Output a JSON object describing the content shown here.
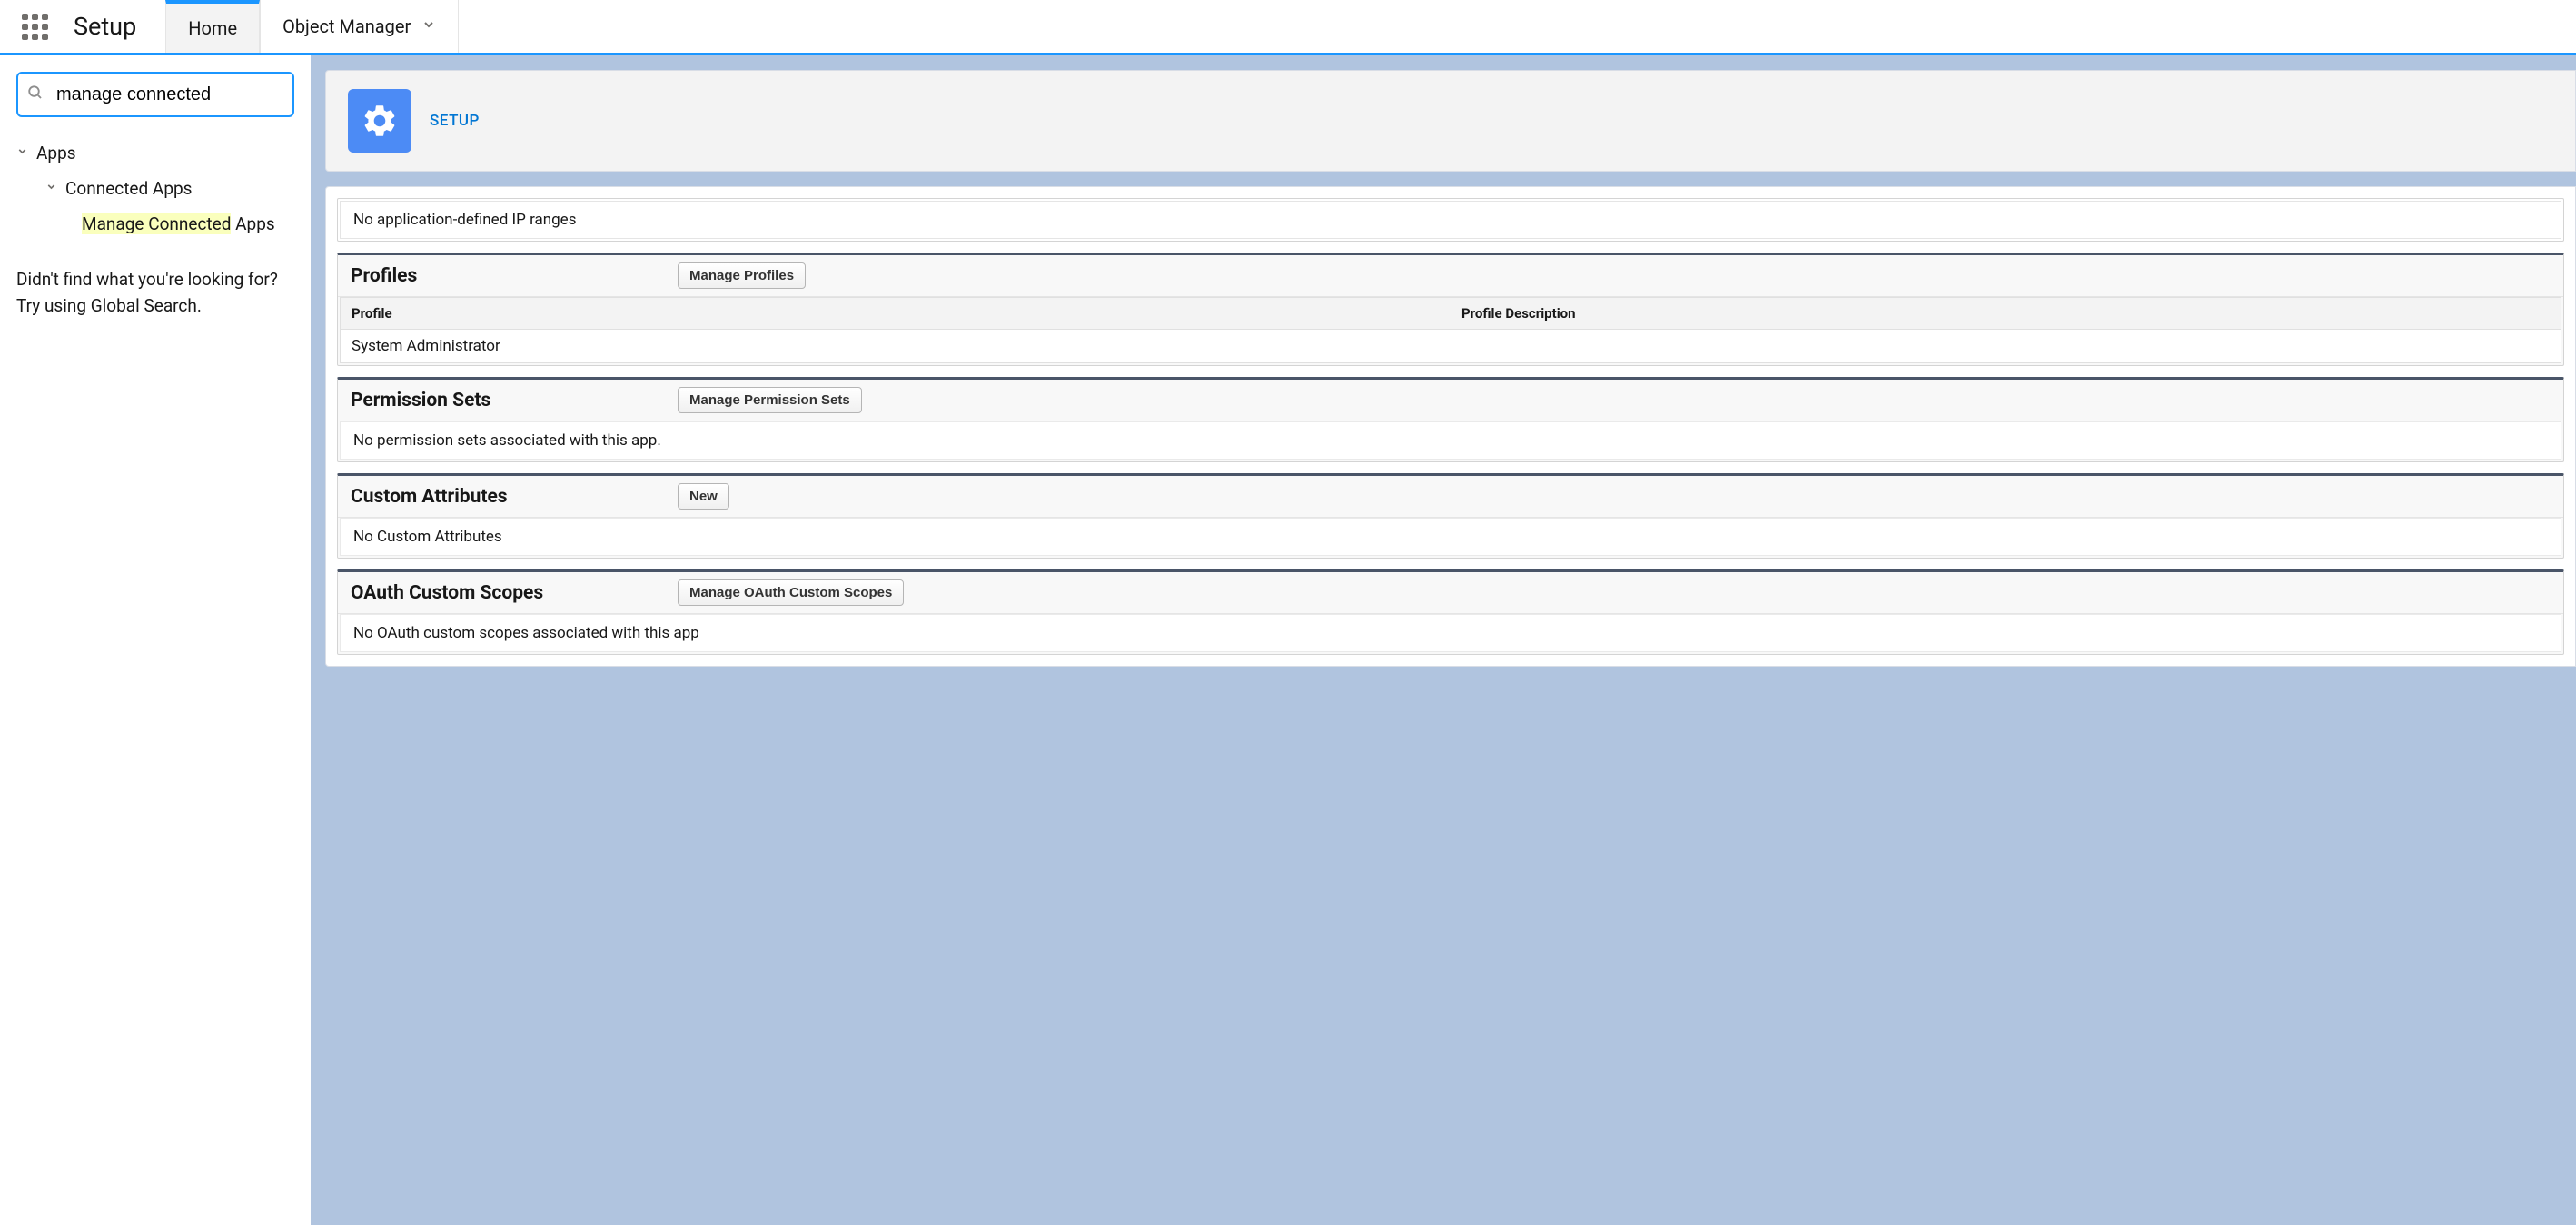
{
  "app": {
    "title": "Setup"
  },
  "tabs": {
    "home": "Home",
    "objectManager": "Object Manager"
  },
  "sidebar": {
    "searchValue": "manage connected",
    "tree": {
      "apps": "Apps",
      "connectedApps": "Connected Apps",
      "manageConnectedAppsHighlight": "Manage Connected",
      "manageConnectedAppsRest": " Apps"
    },
    "helpLine1": "Didn't find what you're looking for?",
    "helpLine2": "Try using Global Search."
  },
  "headerCard": {
    "label": "SETUP"
  },
  "ipRanges": {
    "body": "No application-defined IP ranges"
  },
  "profiles": {
    "title": "Profiles",
    "button": "Manage Profiles",
    "col1": "Profile",
    "col2": "Profile Description",
    "row1": "System Administrator"
  },
  "permissionSets": {
    "title": "Permission Sets",
    "button": "Manage Permission Sets",
    "body": "No permission sets associated with this app."
  },
  "customAttributes": {
    "title": "Custom Attributes",
    "button": "New",
    "body": "No Custom Attributes"
  },
  "oauthScopes": {
    "title": "OAuth Custom Scopes",
    "button": "Manage OAuth Custom Scopes",
    "body": "No OAuth custom scopes associated with this app"
  }
}
